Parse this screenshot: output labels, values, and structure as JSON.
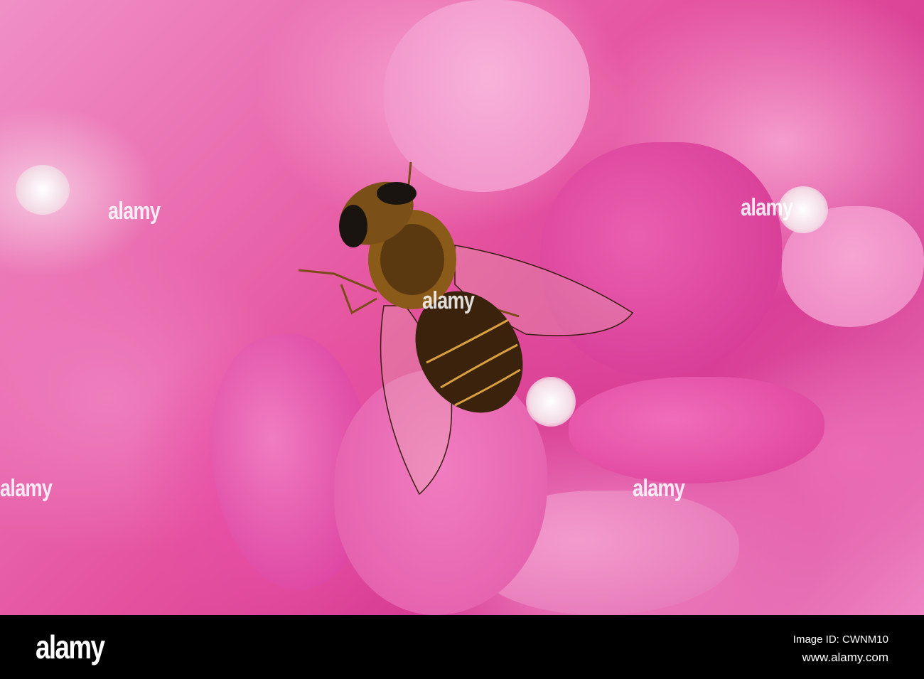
{
  "photo": {
    "subject": "Hoverfly on pink hydrangea",
    "watermarks": [
      "alamy",
      "alamy",
      "alamy",
      "alamy",
      "alamy"
    ]
  },
  "footer": {
    "logo": "alamy",
    "image_id": "Image ID: CWNM10",
    "website": "www.alamy.com"
  }
}
